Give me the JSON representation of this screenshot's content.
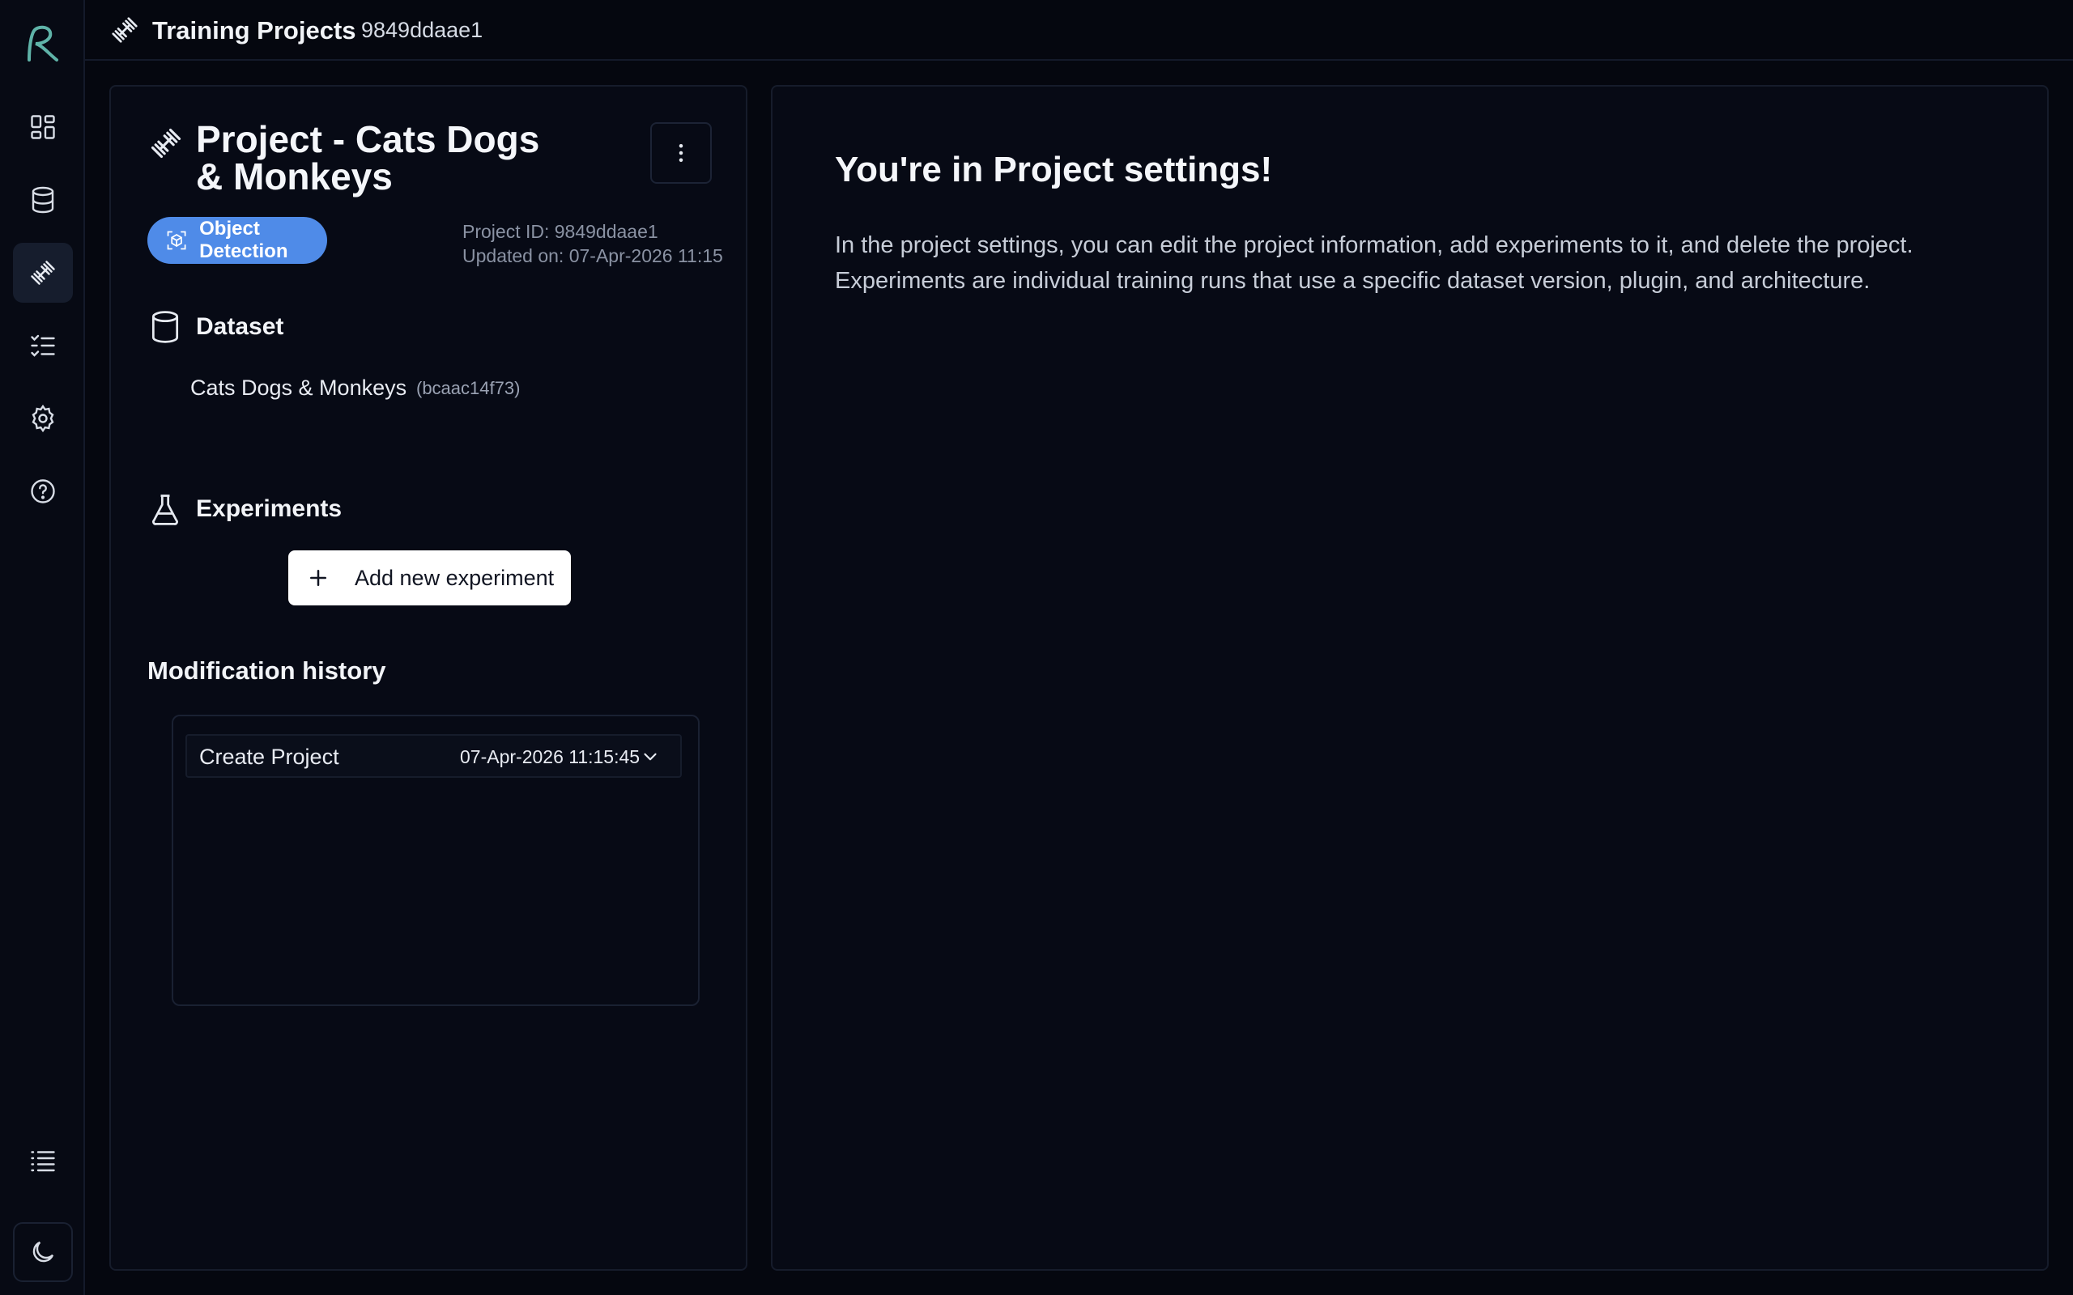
{
  "header": {
    "title": "Training Projects",
    "id": "9849ddaae1"
  },
  "rail": {
    "items": [
      {
        "icon": "dashboard-icon"
      },
      {
        "icon": "database-icon"
      },
      {
        "icon": "dumbbell-icon",
        "active": true
      },
      {
        "icon": "checklist-icon"
      },
      {
        "icon": "gear-icon"
      },
      {
        "icon": "help-icon"
      }
    ],
    "bottom": [
      {
        "icon": "list-icon"
      },
      {
        "icon": "moon-icon"
      }
    ],
    "accent": "#5fb3a8"
  },
  "project": {
    "title": "Project - Cats Dogs & Monkeys",
    "type_label": "Object Detection",
    "type_color": "#4f8be8",
    "id_line": "Project ID: 9849ddaae1",
    "updated_line": "Updated on: 07-Apr-2026 11:15",
    "dataset_heading": "Dataset",
    "dataset_name": "Cats Dogs & Monkeys",
    "dataset_hash": "(bcaac14f73)",
    "experiments_heading": "Experiments",
    "add_experiment_label": "Add new experiment",
    "history_heading": "Modification history",
    "history": [
      {
        "action": "Create Project",
        "timestamp": "07-Apr-2026 11:15:45"
      }
    ]
  },
  "info": {
    "title": "You're in Project settings!",
    "line1": "In the project settings, you can edit the project information, add experiments to it, and delete the project.",
    "line2": "Experiments are individual training runs that use a specific dataset version, plugin, and architecture."
  }
}
